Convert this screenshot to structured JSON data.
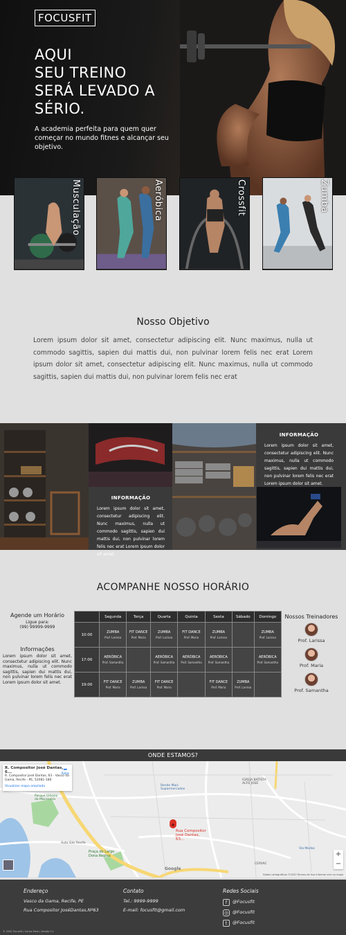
{
  "hero": {
    "logo": "FOCUSFIT",
    "headline": [
      "AQUI",
      "SEU TREINO",
      "SERÁ LEVADO A",
      "SÉRIO."
    ],
    "subtitle": "A academia perfeita para quem quer começar no mundo fitnes e alcançar seu objetivo."
  },
  "cards": [
    {
      "label": "Musculação"
    },
    {
      "label": "Aeróbica"
    },
    {
      "label": "Crossfit"
    },
    {
      "label": "Zumba"
    }
  ],
  "objective": {
    "title": "Nosso Objetivo",
    "text": "Lorem ipsum dolor sit amet, consectetur adipiscing elit. Nunc maximus, nulla ut commodo sagittis, sapien dui mattis dui, non pulvinar lorem felis nec erat Lorem ipsum dolor sit amet, consectetur adipiscing elit. Nunc maximus, nulla ut commodo sagittis, sapien dui mattis dui, non pulvinar lorem felis nec erat"
  },
  "gallery": {
    "info1": {
      "title": "INFORMAÇÃO",
      "text": "Lorem ipsum dolor sit amet, consectetur adipiscing elit. Nunc maximus, nulla ut commodo sagittis, sapien dui mattis dui, non pulvinar lorem felis nec erat Lorem ipsum dolor sit amet."
    },
    "info2": {
      "title": "INFORMAÇÃO",
      "text": "Lorem ipsum dolor sit amet, consectetur adipiscing elit. Nunc maximus, nulla ut commodo sagittis, sapien dui mattis dui, non pulvinar lorem felis nec erat Lorem ipsum dolor sit amet."
    }
  },
  "schedule": {
    "title": "ACOMPANHE NOSSO HORÁRIO",
    "agende_title": "Agende um Horário",
    "ligue": "Ligue para:",
    "phone": "(99) 99999-9999",
    "info_title": "Informações",
    "info_text": "Lorem ipsum dolor sit amet, consectetur adipiscing elit. Nunc maximus, nulla ut commodo sagittis, sapien dui mattis dui, non pulvinar lorem felis nec erat Lorem ipsum dolor sit amet.",
    "days": [
      "Segunda",
      "Terça",
      "Quarta",
      "Quinta",
      "Sexta",
      "Sábado",
      "Domingo"
    ],
    "rows": [
      {
        "time": "10:00",
        "cells": [
          {
            "c": "ZUMBA",
            "p": "Prof. Larissa"
          },
          {
            "c": "FIT DANCE",
            "p": "Prof. Maria"
          },
          {
            "c": "ZUMBA",
            "p": "Prof. Larissa"
          },
          {
            "c": "FIT DANCE",
            "p": "Prof. Maria"
          },
          {
            "c": "ZUMBA",
            "p": "Prof. Larissa"
          },
          {
            "c": "",
            "p": ""
          },
          {
            "c": "ZUMBA",
            "p": "Prof. Larissa"
          }
        ]
      },
      {
        "time": "17:00",
        "cells": [
          {
            "c": "AERÓBICA",
            "p": "Prof. Samantha"
          },
          {
            "c": "",
            "p": ""
          },
          {
            "c": "AERÓBICA",
            "p": "Prof. Samantha"
          },
          {
            "c": "AERÓBICA",
            "p": "Prof. Samantha"
          },
          {
            "c": "AERÓBICA",
            "p": "Prof. Samantha"
          },
          {
            "c": "",
            "p": ""
          },
          {
            "c": "AERÓBICA",
            "p": "Prof. Samantha"
          }
        ]
      },
      {
        "time": "19:00",
        "cells": [
          {
            "c": "FIT DANCE",
            "p": "Prof. Maria"
          },
          {
            "c": "ZUMBA",
            "p": "Prof. Larissa"
          },
          {
            "c": "FIT DANCE",
            "p": "Prof. Maria"
          },
          {
            "c": "",
            "p": ""
          },
          {
            "c": "FIT DANCE",
            "p": "Prof. Maria"
          },
          {
            "c": "ZUMBA",
            "p": "Prof. Larissa"
          },
          {
            "c": "",
            "p": ""
          }
        ]
      }
    ],
    "trainers_title": "Nossos Treinadores",
    "trainers": [
      "Prof. Larissa",
      "Prof. Maria",
      "Prof. Samantha"
    ]
  },
  "map": {
    "title": "ONDE ESTAMOS?",
    "card_name": "R. Compositor José Dantas, 6...",
    "card_addr": "R. Compositor José Dantas, 63 - Vasco da Gama, Recife - PE, 52081-180",
    "card_link": "Visualizar mapa ampliado",
    "card_route": "Rotas",
    "pin_label": "Rua Compositor José Dantas, 63...",
    "labels": [
      "Parque Urbano da Macaxeira",
      "Praça do Largo Dona Regina",
      "Rende Mais Supermercados",
      "IGREJA BATISTA ALTO JOSÉ",
      "Via Modas",
      "CERVAC",
      "Auto Gás Recife",
      "Google"
    ],
    "attribution": "Dados cartográficos ©2020   Termos de Uso   Informar erro no mapa",
    "zoom_in": "+",
    "zoom_out": "−"
  },
  "footer": {
    "endereco_title": "Endereço",
    "endereco_1": "Vasco da Gama, Recife, PE",
    "endereco_2": "Rua Compositor JoséDantas,Nº63",
    "contato_title": "Contato",
    "tel": "Tel.: 9999-9999",
    "email": "E-mail: focusfit@gmail.com",
    "redes_title": "Redes Sociais",
    "social": [
      "@Focusfit",
      "@Focusfit",
      "@Focusfit"
    ],
    "copyright": "© 2020 Focusfit | Carlos Melo | Versão 0.1"
  },
  "colors": {
    "dark": "#3a3a3a",
    "page_bg": "#e0e0e0",
    "pin": "#d93025"
  }
}
